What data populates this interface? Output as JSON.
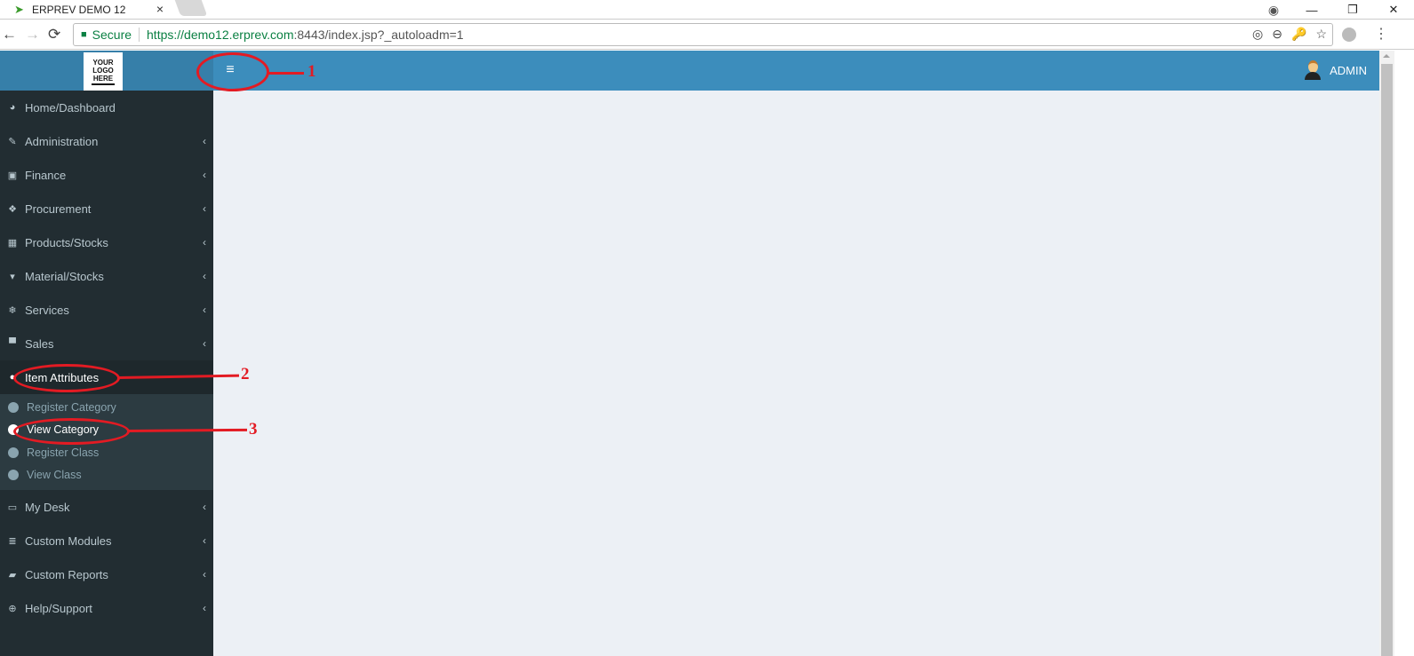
{
  "browser": {
    "tab_title": "ERPREV DEMO 12",
    "tab_close": "×",
    "nav": {
      "back": "←",
      "forward": "→",
      "reload": "⟳"
    },
    "address": {
      "secure_label": "Secure",
      "url_scheme_host": "https://demo12.erprev.com",
      "url_rest": ":8443/index.jsp?_autoloadm=1"
    },
    "window_controls": {
      "account": "◉",
      "minimize": "—",
      "restore": "❐",
      "close": "✕"
    },
    "omnibox_icons": [
      "◎",
      "⊖",
      "🔑",
      "☆"
    ],
    "menu_dots": "⋮"
  },
  "app": {
    "logo_lines": [
      "YOUR",
      "LOGO",
      "HERE"
    ],
    "hamburger": "≡",
    "user_name": "ADMIN",
    "sidebar": {
      "items": [
        {
          "label": "Home/Dashboard",
          "icon": "dashboard-icon",
          "glyph": "◕",
          "has_children": false
        },
        {
          "label": "Administration",
          "icon": "ticket-icon",
          "glyph": "✎",
          "has_children": true
        },
        {
          "label": "Finance",
          "icon": "money-icon",
          "glyph": "▣",
          "has_children": true
        },
        {
          "label": "Procurement",
          "icon": "cubes-icon",
          "glyph": "❖",
          "has_children": true
        },
        {
          "label": "Products/Stocks",
          "icon": "building-icon",
          "glyph": "▦",
          "has_children": true
        },
        {
          "label": "Material/Stocks",
          "icon": "trash-icon",
          "glyph": "▾",
          "has_children": true
        },
        {
          "label": "Services",
          "icon": "snowflake-icon",
          "glyph": "❄",
          "has_children": true
        },
        {
          "label": "Sales",
          "icon": "cart-icon",
          "glyph": "▀",
          "has_children": true
        },
        {
          "label": "Item Attributes",
          "icon": "circle-icon",
          "glyph": "●",
          "has_children": true,
          "active": true,
          "children": [
            {
              "label": "Register Category"
            },
            {
              "label": "View Category",
              "active": true
            },
            {
              "label": "Register Class"
            },
            {
              "label": "View Class"
            }
          ]
        },
        {
          "label": "My Desk",
          "icon": "desktop-icon",
          "glyph": "▭",
          "has_children": true
        },
        {
          "label": "Custom Modules",
          "icon": "database-icon",
          "glyph": "≣",
          "has_children": true
        },
        {
          "label": "Custom Reports",
          "icon": "book-icon",
          "glyph": "▰",
          "has_children": true
        },
        {
          "label": "Help/Support",
          "icon": "life-ring-icon",
          "glyph": "⊕",
          "has_children": true
        }
      ],
      "chevron": "‹"
    }
  },
  "annotations": [
    {
      "number": "1",
      "target": "hamburger-menu"
    },
    {
      "number": "2",
      "target": "Item Attributes"
    },
    {
      "number": "3",
      "target": "View Category"
    }
  ],
  "colors": {
    "header": "#3c8dbc",
    "logo_bg": "#367fa9",
    "sidebar": "#222d32",
    "submenu": "#2c3b41",
    "content": "#ecf0f5",
    "annotation": "#e31b23"
  }
}
